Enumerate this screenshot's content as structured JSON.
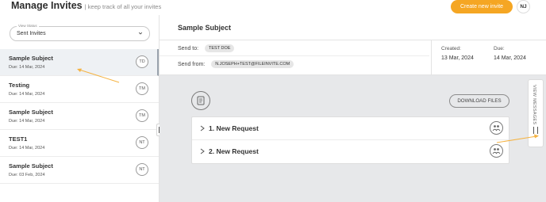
{
  "header": {
    "title": "Manage Invites",
    "subtitle": "| keep track of all your invites",
    "create_button": "Create new invite",
    "user_initials": "NJ"
  },
  "view_select": {
    "label": "View Status",
    "value": "Sent Invites"
  },
  "invites": [
    {
      "title": "Sample Subject",
      "due": "Due: 14 Mar, 2024",
      "avatar": "TD",
      "active": true
    },
    {
      "title": "Testing",
      "due": "Due: 14 Mar, 2024",
      "avatar": "TM",
      "active": false
    },
    {
      "title": "Sample Subject",
      "due": "Due: 14 Mar, 2024",
      "avatar": "TM",
      "active": false
    },
    {
      "title": "TEST1",
      "due": "Due: 14 Mar, 2024",
      "avatar": "NT",
      "active": false
    },
    {
      "title": "Sample Subject",
      "due": "Due: 03 Feb, 2024",
      "avatar": "NT",
      "active": false
    }
  ],
  "detail": {
    "subject": "Sample Subject",
    "send_to_label": "Send to:",
    "send_to_value": "TEST DOE",
    "send_from_label": "Send from:",
    "send_from_value": "N.JOSEPH+TEST@FILEINVITE.COM",
    "created_label": "Created:",
    "created_value": "13 Mar, 2024",
    "due_label": "Due:",
    "due_value": "14 Mar, 2024",
    "download_button": "DOWNLOAD FILES",
    "requests": [
      {
        "label": "1. New Request"
      },
      {
        "label": "2. New Request"
      }
    ],
    "view_messages": "VIEW MESSAGES"
  },
  "colors": {
    "accent": "#f5a623",
    "annotation_arrow": "#f5b342",
    "main_background": "#e7e8ea"
  }
}
